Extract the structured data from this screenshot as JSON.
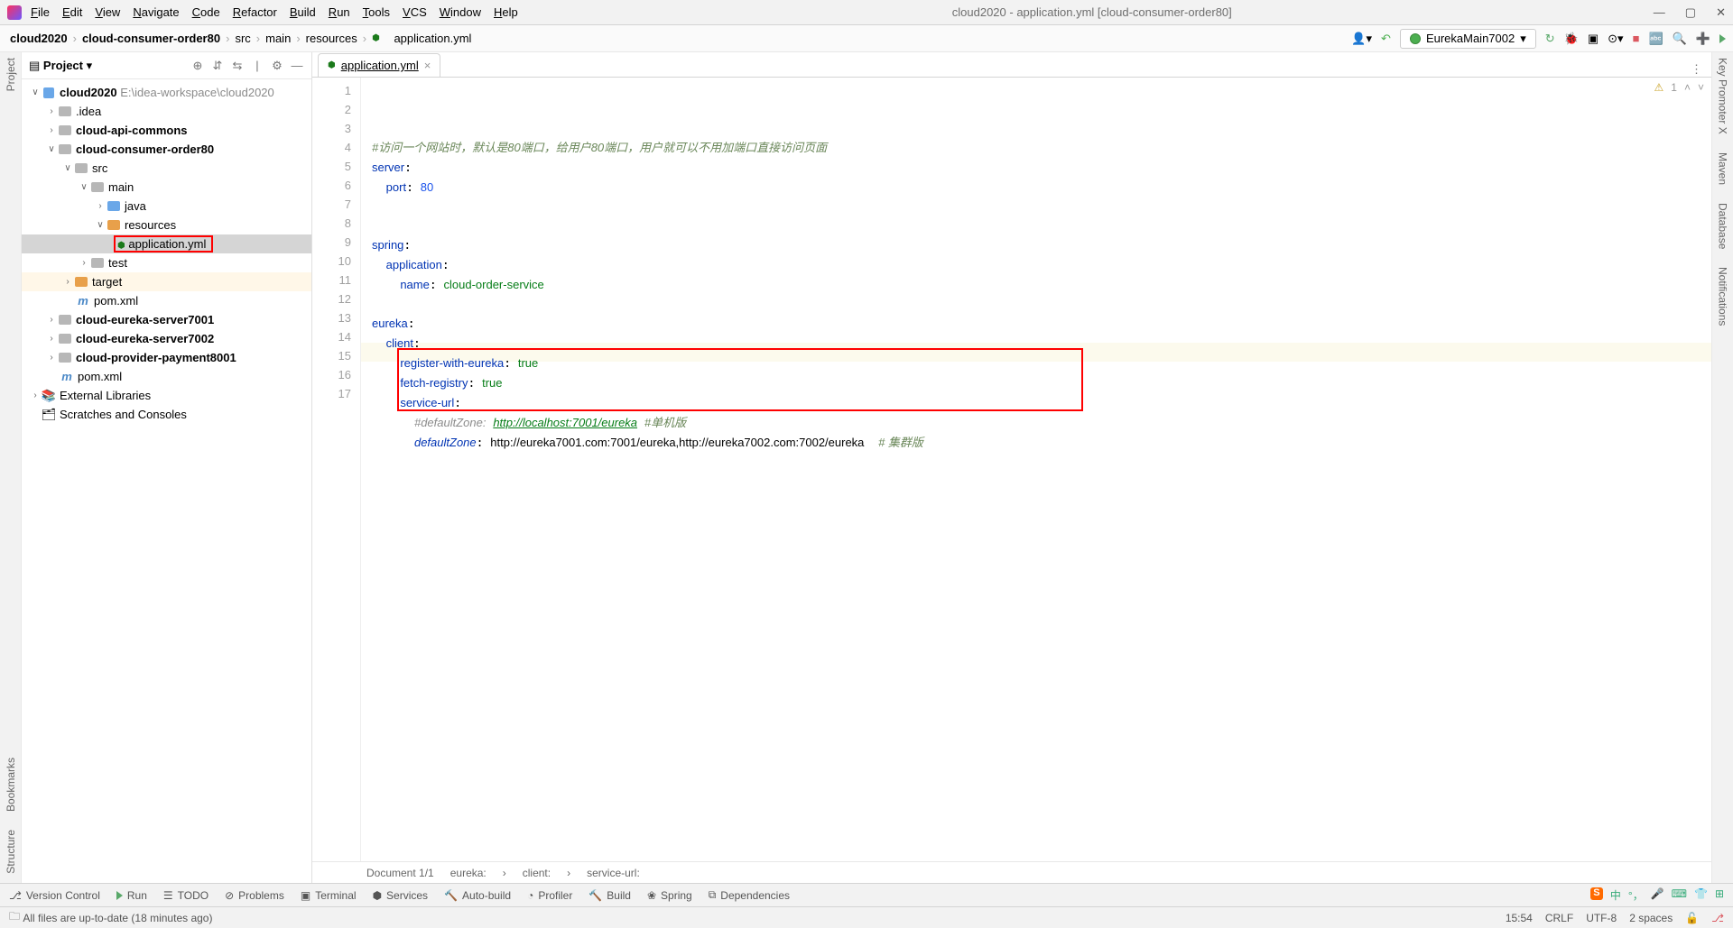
{
  "window": {
    "title": "cloud2020 - application.yml [cloud-consumer-order80]"
  },
  "menu": [
    "File",
    "Edit",
    "View",
    "Navigate",
    "Code",
    "Refactor",
    "Build",
    "Run",
    "Tools",
    "VCS",
    "Window",
    "Help"
  ],
  "breadcrumb": [
    "cloud2020",
    "cloud-consumer-order80",
    "src",
    "main",
    "resources",
    "application.yml"
  ],
  "run_config": "EurekaMain7002",
  "project_panel": {
    "title": "Project"
  },
  "tree": {
    "root": "cloud2020",
    "root_path": "E:\\idea-workspace\\cloud2020",
    "idea": ".idea",
    "api_commons": "cloud-api-commons",
    "consumer": "cloud-consumer-order80",
    "src": "src",
    "main": "main",
    "java": "java",
    "resources": "resources",
    "app_yml": "application.yml",
    "test": "test",
    "target": "target",
    "pom": "pom.xml",
    "eureka1": "cloud-eureka-server7001",
    "eureka2": "cloud-eureka-server7002",
    "provider": "cloud-provider-payment8001",
    "ext_lib": "External Libraries",
    "scratches": "Scratches and Consoles"
  },
  "tab": {
    "name": "application.yml"
  },
  "code": {
    "l1_com": "#访问一个网站时，默认是80端口，给用户80端口，用户就可以不用加端口直接访问页面",
    "l2_k": "server",
    "l3_k": "port",
    "l3_v": "80",
    "l6_k": "spring",
    "l7_k": "application",
    "l8_k": "name",
    "l8_v": "cloud-order-service",
    "l10_k": "eureka",
    "l11_k": "client",
    "l12_k": "register-with-eureka",
    "l12_v": "true",
    "l13_k": "fetch-registry",
    "l13_v": "true",
    "l14_k": "service-url",
    "l15_com1": "#defaultZone:",
    "l15_url": "http://localhost:7001/eureka",
    "l15_com2": "#单机版",
    "l16_k": "defaultZone",
    "l16_v": "http://eureka7001.com:7001/eureka,http://eureka7002.com:7002/eureka",
    "l16_com": "# 集群版"
  },
  "gutter": [
    "1",
    "2",
    "3",
    "4",
    "5",
    "6",
    "7",
    "8",
    "9",
    "10",
    "11",
    "12",
    "13",
    "14",
    "15",
    "16",
    "17"
  ],
  "editor_crumb": {
    "doc": "Document 1/1",
    "c1": "eureka:",
    "c2": "client:",
    "c3": "service-url:"
  },
  "inspect": {
    "warn": "1"
  },
  "toolwin": {
    "vc": "Version Control",
    "run": "Run",
    "todo": "TODO",
    "problems": "Problems",
    "terminal": "Terminal",
    "services": "Services",
    "autobuild": "Auto-build",
    "profiler": "Profiler",
    "build": "Build",
    "spring": "Spring",
    "deps": "Dependencies"
  },
  "status": {
    "msg": "All files are up-to-date (18 minutes ago)",
    "time": "15:54",
    "eol": "CRLF",
    "enc": "UTF-8",
    "indent": "2 spaces"
  },
  "leftrail": {
    "project": "Project",
    "bookmarks": "Bookmarks",
    "structure": "Structure"
  },
  "rightrail": {
    "kp": "Key Promoter X",
    "maven": "Maven",
    "db": "Database",
    "notif": "Notifications"
  }
}
